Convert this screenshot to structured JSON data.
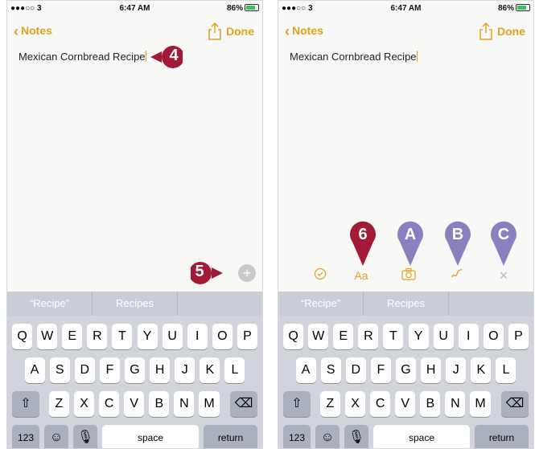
{
  "status_bar": {
    "carrier": "●●●○○ 3",
    "time": "6:47 AM",
    "battery_left": "86%",
    "battery_right": "86%"
  },
  "nav": {
    "back_label": "Notes",
    "done_label": "Done"
  },
  "note": {
    "text": "Mexican Cornbread Recipe"
  },
  "suggestions": [
    "“Recipe”",
    "Recipes",
    ""
  ],
  "keyboard": {
    "row1": [
      "Q",
      "W",
      "E",
      "R",
      "T",
      "Y",
      "U",
      "I",
      "O",
      "P"
    ],
    "row2": [
      "A",
      "S",
      "D",
      "F",
      "G",
      "H",
      "J",
      "K",
      "L"
    ],
    "row3": [
      "Z",
      "X",
      "C",
      "V",
      "B",
      "N",
      "M"
    ],
    "numbers_key": "123",
    "space_key": "space",
    "return_key": "return"
  },
  "callouts": {
    "left_note": "4",
    "left_plus": "5",
    "format": "6",
    "camera": "A",
    "sketch": "B",
    "close": "C"
  },
  "icons": {
    "checklist": "checklist-icon",
    "format": "format-icon",
    "camera": "camera-icon",
    "sketch": "sketch-icon",
    "close": "close-icon"
  },
  "colors": {
    "accent": "#e0a21d",
    "callout_red": "#a31a37",
    "callout_purple": "#8b80bf"
  }
}
